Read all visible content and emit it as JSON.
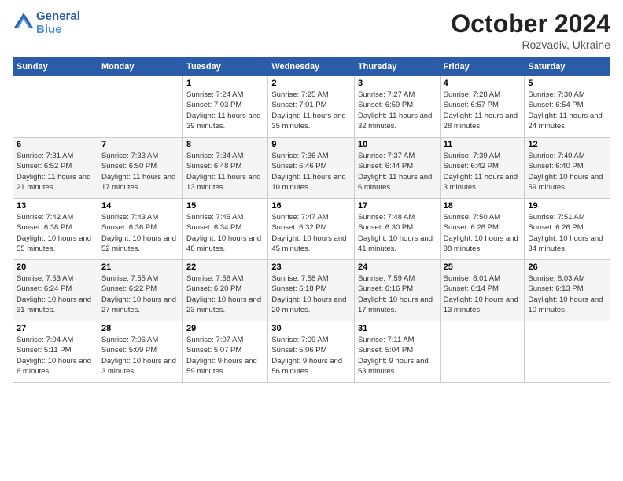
{
  "logo": {
    "line1": "General",
    "line2": "Blue"
  },
  "title": "October 2024",
  "location": "Rozvadiv, Ukraine",
  "days_of_week": [
    "Sunday",
    "Monday",
    "Tuesday",
    "Wednesday",
    "Thursday",
    "Friday",
    "Saturday"
  ],
  "weeks": [
    [
      {
        "day": "",
        "info": ""
      },
      {
        "day": "",
        "info": ""
      },
      {
        "day": "1",
        "info": "Sunrise: 7:24 AM\nSunset: 7:03 PM\nDaylight: 11 hours and 39 minutes."
      },
      {
        "day": "2",
        "info": "Sunrise: 7:25 AM\nSunset: 7:01 PM\nDaylight: 11 hours and 35 minutes."
      },
      {
        "day": "3",
        "info": "Sunrise: 7:27 AM\nSunset: 6:59 PM\nDaylight: 11 hours and 32 minutes."
      },
      {
        "day": "4",
        "info": "Sunrise: 7:28 AM\nSunset: 6:57 PM\nDaylight: 11 hours and 28 minutes."
      },
      {
        "day": "5",
        "info": "Sunrise: 7:30 AM\nSunset: 6:54 PM\nDaylight: 11 hours and 24 minutes."
      }
    ],
    [
      {
        "day": "6",
        "info": "Sunrise: 7:31 AM\nSunset: 6:52 PM\nDaylight: 11 hours and 21 minutes."
      },
      {
        "day": "7",
        "info": "Sunrise: 7:33 AM\nSunset: 6:50 PM\nDaylight: 11 hours and 17 minutes."
      },
      {
        "day": "8",
        "info": "Sunrise: 7:34 AM\nSunset: 6:48 PM\nDaylight: 11 hours and 13 minutes."
      },
      {
        "day": "9",
        "info": "Sunrise: 7:36 AM\nSunset: 6:46 PM\nDaylight: 11 hours and 10 minutes."
      },
      {
        "day": "10",
        "info": "Sunrise: 7:37 AM\nSunset: 6:44 PM\nDaylight: 11 hours and 6 minutes."
      },
      {
        "day": "11",
        "info": "Sunrise: 7:39 AM\nSunset: 6:42 PM\nDaylight: 11 hours and 3 minutes."
      },
      {
        "day": "12",
        "info": "Sunrise: 7:40 AM\nSunset: 6:40 PM\nDaylight: 10 hours and 59 minutes."
      }
    ],
    [
      {
        "day": "13",
        "info": "Sunrise: 7:42 AM\nSunset: 6:38 PM\nDaylight: 10 hours and 55 minutes."
      },
      {
        "day": "14",
        "info": "Sunrise: 7:43 AM\nSunset: 6:36 PM\nDaylight: 10 hours and 52 minutes."
      },
      {
        "day": "15",
        "info": "Sunrise: 7:45 AM\nSunset: 6:34 PM\nDaylight: 10 hours and 48 minutes."
      },
      {
        "day": "16",
        "info": "Sunrise: 7:47 AM\nSunset: 6:32 PM\nDaylight: 10 hours and 45 minutes."
      },
      {
        "day": "17",
        "info": "Sunrise: 7:48 AM\nSunset: 6:30 PM\nDaylight: 10 hours and 41 minutes."
      },
      {
        "day": "18",
        "info": "Sunrise: 7:50 AM\nSunset: 6:28 PM\nDaylight: 10 hours and 38 minutes."
      },
      {
        "day": "19",
        "info": "Sunrise: 7:51 AM\nSunset: 6:26 PM\nDaylight: 10 hours and 34 minutes."
      }
    ],
    [
      {
        "day": "20",
        "info": "Sunrise: 7:53 AM\nSunset: 6:24 PM\nDaylight: 10 hours and 31 minutes."
      },
      {
        "day": "21",
        "info": "Sunrise: 7:55 AM\nSunset: 6:22 PM\nDaylight: 10 hours and 27 minutes."
      },
      {
        "day": "22",
        "info": "Sunrise: 7:56 AM\nSunset: 6:20 PM\nDaylight: 10 hours and 23 minutes."
      },
      {
        "day": "23",
        "info": "Sunrise: 7:58 AM\nSunset: 6:18 PM\nDaylight: 10 hours and 20 minutes."
      },
      {
        "day": "24",
        "info": "Sunrise: 7:59 AM\nSunset: 6:16 PM\nDaylight: 10 hours and 17 minutes."
      },
      {
        "day": "25",
        "info": "Sunrise: 8:01 AM\nSunset: 6:14 PM\nDaylight: 10 hours and 13 minutes."
      },
      {
        "day": "26",
        "info": "Sunrise: 8:03 AM\nSunset: 6:13 PM\nDaylight: 10 hours and 10 minutes."
      }
    ],
    [
      {
        "day": "27",
        "info": "Sunrise: 7:04 AM\nSunset: 5:11 PM\nDaylight: 10 hours and 6 minutes."
      },
      {
        "day": "28",
        "info": "Sunrise: 7:06 AM\nSunset: 5:09 PM\nDaylight: 10 hours and 3 minutes."
      },
      {
        "day": "29",
        "info": "Sunrise: 7:07 AM\nSunset: 5:07 PM\nDaylight: 9 hours and 59 minutes."
      },
      {
        "day": "30",
        "info": "Sunrise: 7:09 AM\nSunset: 5:06 PM\nDaylight: 9 hours and 56 minutes."
      },
      {
        "day": "31",
        "info": "Sunrise: 7:11 AM\nSunset: 5:04 PM\nDaylight: 9 hours and 53 minutes."
      },
      {
        "day": "",
        "info": ""
      },
      {
        "day": "",
        "info": ""
      }
    ]
  ]
}
